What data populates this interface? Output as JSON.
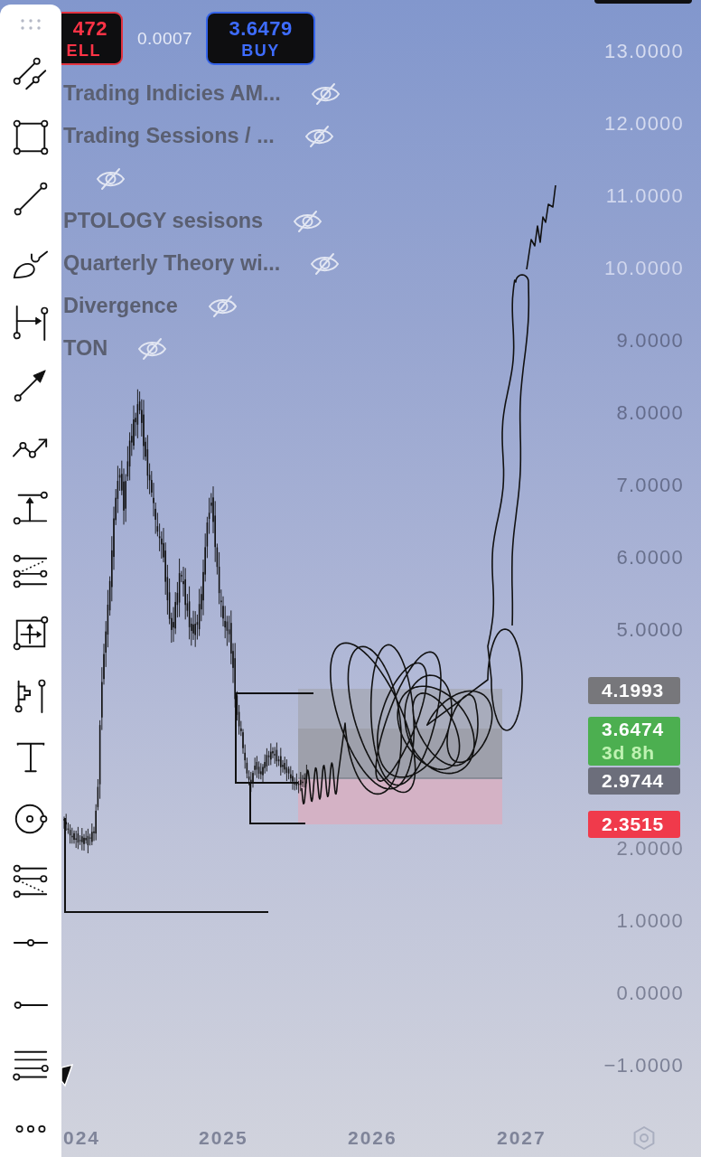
{
  "quote": {
    "sell": {
      "price": "472",
      "label": "ELL"
    },
    "spread": "0.0007",
    "buy": {
      "price": "3.6479",
      "label": "BUY"
    }
  },
  "indicators": [
    {
      "label": "Trading Indicies AM...",
      "hidden": true
    },
    {
      "label": "Trading Sessions / ...",
      "hidden": true
    },
    {
      "hidden": true
    },
    {
      "label": "PTOLOGY sesisons",
      "hidden": true
    },
    {
      "label": "Quarterly Theory wi...",
      "hidden": true
    },
    {
      "label": "Divergence",
      "hidden": true
    },
    {
      "label": "TON",
      "hidden": true
    }
  ],
  "price_axis": {
    "upper_labels": [
      "13.0000",
      "12.0000",
      "11.0000",
      "10.0000",
      "9.0000",
      "8.0000",
      "7.0000",
      "6.0000",
      "5.0000"
    ],
    "lower_labels": [
      "2.0000",
      "1.0000",
      "0.0000",
      "−1.0000"
    ]
  },
  "price_badges": [
    {
      "price": "4.1993",
      "color": "#77777b"
    },
    {
      "price": "3.6474",
      "countdown": "3d 8h",
      "color": "#4caf50"
    },
    {
      "price": "2.9744",
      "color": "#6c6e7b"
    },
    {
      "price": "2.3515",
      "color": "#f03a4b"
    }
  ],
  "time_axis": {
    "labels": [
      "024",
      "2025",
      "2026",
      "2027"
    ]
  }
}
